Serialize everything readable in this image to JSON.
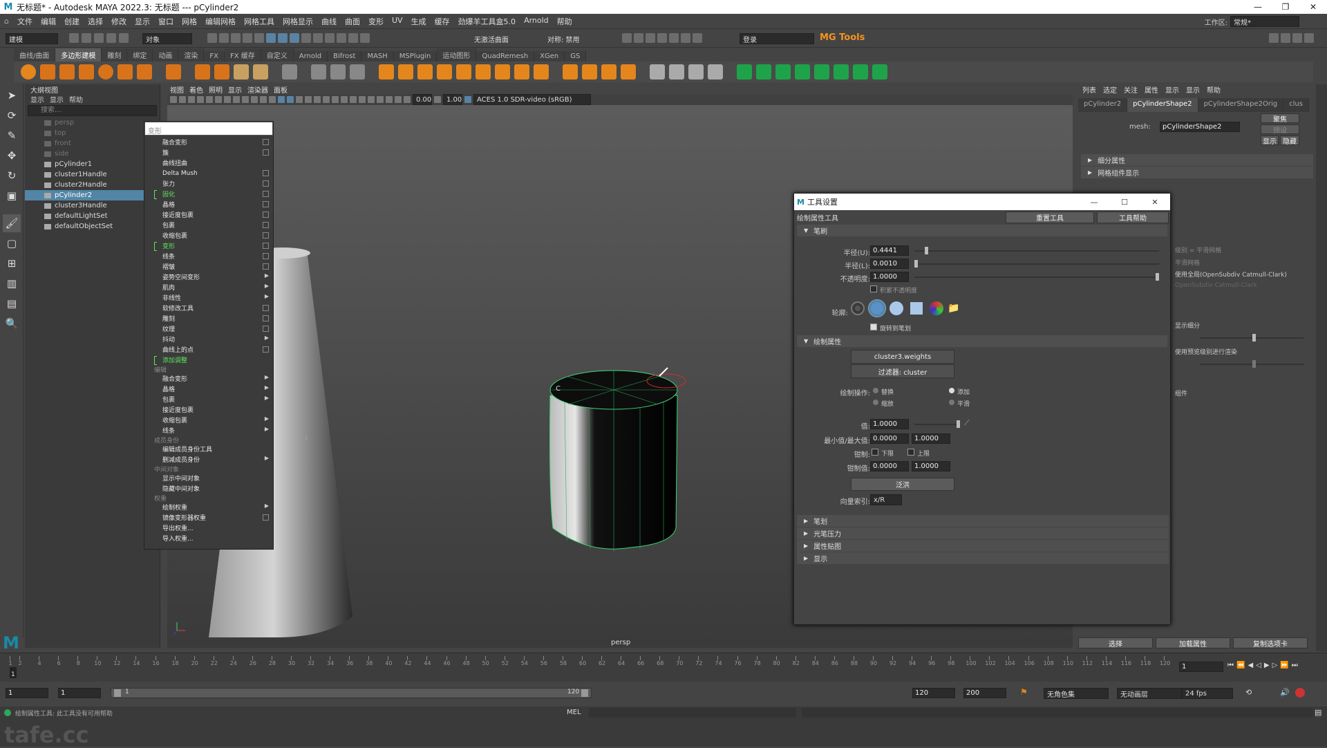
{
  "window": {
    "title": "无标题* - Autodesk MAYA 2022.3: 无标题   ---   pCylinder2"
  },
  "menubar": [
    "文件",
    "编辑",
    "创建",
    "选择",
    "修改",
    "显示",
    "窗口",
    "网格",
    "编辑网格",
    "网格工具",
    "网格显示",
    "曲线",
    "曲面",
    "变形",
    "UV",
    "生成",
    "缓存",
    "劲爆羊工具盒5.0",
    "Arnold",
    "帮助"
  ],
  "workspace": {
    "label": "工作区:",
    "value": "常规*"
  },
  "statusline": {
    "mode": "建模",
    "object_field": "对象",
    "live_surface": "无激活曲面",
    "symmetry": "对称: 禁用",
    "login": "登录",
    "mgtools": "MG Tools"
  },
  "shelf_tabs": [
    "曲线/曲面",
    "多边形建模",
    "雕刻",
    "绑定",
    "动画",
    "渲染",
    "FX",
    "FX 缓存",
    "自定义",
    "Arnold",
    "Bifrost",
    "MASH",
    "MSPlugin",
    "运动图形",
    "QuadRemesh",
    "XGen",
    "GS"
  ],
  "shelf_selected": "多边形建模",
  "outliner": {
    "menu": [
      "显示",
      "显示",
      "帮助"
    ],
    "search_placeholder": "搜索...",
    "items": [
      {
        "label": "persp",
        "dim": true
      },
      {
        "label": "top",
        "dim": true
      },
      {
        "label": "front",
        "dim": true
      },
      {
        "label": "side",
        "dim": true
      },
      {
        "label": "pCylinder1",
        "dim": false
      },
      {
        "label": "cluster1Handle",
        "dim": false
      },
      {
        "label": "cluster2Handle",
        "dim": false
      },
      {
        "label": "pCylinder2",
        "dim": false,
        "sel": true
      },
      {
        "label": "cluster3Handle",
        "dim": false
      },
      {
        "label": "defaultLightSet",
        "dim": false
      },
      {
        "label": "defaultObjectSet",
        "dim": false
      }
    ],
    "panel_title": "大纲视图"
  },
  "viewport": {
    "menu": [
      "视图",
      "着色",
      "照明",
      "显示",
      "渲染器",
      "面板"
    ],
    "exposure": "0.00",
    "gamma": "1.00",
    "colorspace": "ACES 1.0 SDR-video (sRGB)",
    "camera": "persp"
  },
  "context_menu": {
    "filter": "变形",
    "items": [
      {
        "t": "融合变形",
        "k": "cb"
      },
      {
        "t": "簇",
        "k": "cb"
      },
      {
        "t": "曲线扭曲",
        "k": ""
      },
      {
        "t": "Delta Mush",
        "k": "cb"
      },
      {
        "t": "张力",
        "k": "cb"
      },
      {
        "t": "固化",
        "k": "cb",
        "hl": true
      },
      {
        "t": "晶格",
        "k": "cb"
      },
      {
        "t": "接近度包裹",
        "k": "cb"
      },
      {
        "t": "包裹",
        "k": "cb"
      },
      {
        "t": "收缩包裹",
        "k": "cb"
      },
      {
        "t": "变形",
        "k": "cb",
        "hl": true
      },
      {
        "t": "线条",
        "k": "cb"
      },
      {
        "t": "褶皱",
        "k": "cb"
      },
      {
        "t": "姿势空间变形",
        "k": "ar"
      },
      {
        "t": "肌肉",
        "k": "ar"
      },
      {
        "t": "非线性",
        "k": "ar"
      },
      {
        "t": "软修改工具",
        "k": "cb"
      },
      {
        "t": "雕刻",
        "k": "cb"
      },
      {
        "t": "纹理",
        "k": "cb"
      },
      {
        "t": "抖动",
        "k": "ar"
      },
      {
        "t": "曲线上的点",
        "k": "cb"
      },
      {
        "t": "添加调整",
        "k": "",
        "hl": true
      },
      {
        "sec": "编辑"
      },
      {
        "t": "融合变形",
        "k": "ar"
      },
      {
        "t": "晶格",
        "k": "ar"
      },
      {
        "t": "包裹",
        "k": "ar"
      },
      {
        "t": "接近度包裹",
        "k": ""
      },
      {
        "t": "收缩包裹",
        "k": "ar"
      },
      {
        "t": "线条",
        "k": "ar"
      },
      {
        "sec": "成员身份"
      },
      {
        "t": "编辑成员身份工具",
        "k": ""
      },
      {
        "t": "删减成员身份",
        "k": "ar"
      },
      {
        "sec": "中间对象"
      },
      {
        "t": "显示中间对象",
        "k": ""
      },
      {
        "t": "隐藏中间对象",
        "k": ""
      },
      {
        "sec": "权重"
      },
      {
        "t": "绘制权重",
        "k": "ar"
      },
      {
        "t": "镜像变形器权重",
        "k": "cb"
      },
      {
        "t": "导出权重...",
        "k": ""
      },
      {
        "t": "导入权重...",
        "k": ""
      }
    ]
  },
  "channel_box": {
    "menu": [
      "列表",
      "选定",
      "关注",
      "属性",
      "显示",
      "显示",
      "帮助"
    ],
    "tabs": [
      "pCylinder2",
      "pCylinderShape2",
      "pCylinderShape2Orig",
      "clus"
    ],
    "selected_tab": "pCylinderShape2",
    "mesh_label": "mesh:",
    "mesh_value": "pCylinderShape2",
    "focus_btn": "聚焦",
    "preset_btn": "预设",
    "show_btn": "显示",
    "hide_btn": "隐藏",
    "sections": [
      "细分属性",
      "网格组件显示"
    ],
    "right_texts": [
      "级别 = 平滑网格",
      "平滑网格",
      "使用全局(OpenSubdiv Catmull-Clark)",
      "OpenSubdiv Catmull-Clark",
      "显示细分",
      "使用预览级别进行渲染",
      "组件"
    ],
    "bottom": [
      "选择",
      "加载属性",
      "复制选项卡"
    ]
  },
  "tool_settings": {
    "title": "工具设置",
    "tool_name": "绘制属性工具",
    "reset": "重置工具",
    "help": "工具帮助",
    "brush_section": "笔刷",
    "radius_u_label": "半径(U):",
    "radius_u": "0.4441",
    "radius_l_label": "半径(L):",
    "radius_l": "0.0010",
    "opacity_label": "不透明度:",
    "opacity": "1.0000",
    "accumulate": "积累不透明度",
    "profile_label": "轮廓:",
    "rotate_to_stroke": "旋转到笔划",
    "paint_section": "绘制属性",
    "attr_btn": "cluster3.weights",
    "filter_btn": "过滤器: cluster",
    "op_label": "绘制操作:",
    "ops": [
      "替换",
      "添加",
      "缩放",
      "平滑"
    ],
    "value_label": "值:",
    "value": "1.0000",
    "minmax_label": "最小值/最大值:",
    "min": "0.0000",
    "max": "1.0000",
    "clamp_label": "钳制:",
    "clamp_lower": "下限",
    "clamp_upper": "上限",
    "clamp_values_label": "钳制值:",
    "clamp_min": "0.0000",
    "clamp_max": "1.0000",
    "flood": "泛洪",
    "vector_label": "向量索引:",
    "vector_value": "x/R",
    "collapsed": [
      "笔划",
      "光笔压力",
      "属性贴图",
      "显示"
    ]
  },
  "timeline": {
    "ticks": [
      "1",
      "2",
      "4",
      "6",
      "8",
      "10",
      "12",
      "14",
      "16",
      "18",
      "20",
      "22",
      "24",
      "26",
      "28",
      "30",
      "32",
      "34",
      "36",
      "38",
      "40",
      "42",
      "44",
      "46",
      "48",
      "50",
      "52",
      "54",
      "56",
      "58",
      "60",
      "62",
      "64",
      "66",
      "68",
      "70",
      "72",
      "74",
      "76",
      "78",
      "80",
      "82",
      "84",
      "86",
      "88",
      "90",
      "92",
      "94",
      "96",
      "98",
      "100",
      "102",
      "104",
      "106",
      "108",
      "110",
      "112",
      "114",
      "116",
      "118",
      "120"
    ],
    "current": "1"
  },
  "range": {
    "start": "1",
    "inner_start": "1",
    "play_start": "1",
    "play_end": "120",
    "inner_end": "120",
    "end": "200",
    "char_set": "无角色集",
    "anim_layer": "无动画层",
    "fps": "24 fps"
  },
  "cmdline": {
    "label": "MEL"
  },
  "help": {
    "text": "绘制属性工具: 此工具没有可用帮助"
  },
  "watermark": "tafe.cc"
}
